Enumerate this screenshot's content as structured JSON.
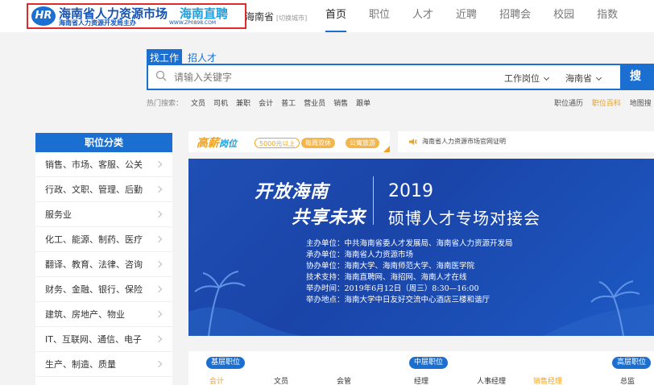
{
  "header": {
    "logo_mark": "HR",
    "logo_main": "海南省人力资源市场",
    "logo_main2": "海南直聘",
    "logo_sub": "海南省人力资源开发局主办",
    "logo_url": "WWW.ZP0898.COM",
    "city": "海南省",
    "city_switch": "[切换城市]",
    "nav": [
      {
        "label": "首页",
        "active": true
      },
      {
        "label": "职位"
      },
      {
        "label": "人才"
      },
      {
        "label": "近聘"
      },
      {
        "label": "招聘会"
      },
      {
        "label": "校园"
      },
      {
        "label": "指数"
      }
    ]
  },
  "search": {
    "tabs": [
      "找工作",
      "招人才"
    ],
    "placeholder": "请输入关键字",
    "select_type": "工作岗位",
    "select_region": "海南省",
    "button": "搜",
    "hot_label": "热门搜索：",
    "hot_items": [
      "文员",
      "司机",
      "兼职",
      "会计",
      "普工",
      "营业员",
      "销售",
      "跟单"
    ],
    "right_links": [
      {
        "label": "职位通历",
        "highlight": false
      },
      {
        "label": "职位百科",
        "highlight": true
      },
      {
        "label": "地图搜",
        "highlight": false
      }
    ]
  },
  "sidebar": {
    "title": "职位分类",
    "items": [
      "销售、市场、客服、公关",
      "行政、文职、管理、后勤",
      "服务业",
      "化工、能源、制药、医疗",
      "翻译、教育、法律、咨询",
      "财务、金融、银行、保险",
      "建筑、房地产、物业",
      "IT、互联网、通信、电子",
      "生产、制造、质量"
    ]
  },
  "promo": {
    "logo_a": "高薪",
    "logo_b": "岗位",
    "tags": [
      "5000元以上",
      "每周双休",
      "公寓旅游"
    ]
  },
  "notice": {
    "text": "海南省人力资源市场官网证明"
  },
  "banner": {
    "calli_line1": "开放海南",
    "calli_line2": "共享未来",
    "year": "2019",
    "title": "硕博人才专场对接会",
    "info": [
      "主办单位：中共海南省委人才发展局、海南省人力资源开发局",
      "承办单位：海南省人力资源市场",
      "协办单位：海南大学、海南师范大学、海南医学院",
      "技术支持：海南直聘网、海招网、海南人才在线",
      "举办时间：2019年6月12日（周三）8:30—16:00",
      "举办地点：海南大学中日友好交流中心酒店三楼和谐厅"
    ]
  },
  "levels": {
    "groups": [
      {
        "title": "基层职位",
        "items": [
          {
            "label": "会计",
            "orange": true
          },
          {
            "label": "文员"
          },
          {
            "label": "会管"
          }
        ]
      },
      {
        "title": "中层职位",
        "items": [
          {
            "label": "经理"
          },
          {
            "label": "人事经理"
          },
          {
            "label": "销售经理",
            "orange": true
          }
        ]
      },
      {
        "title": "高层职位",
        "items": [
          {
            "label": "总监"
          }
        ]
      }
    ]
  },
  "colors": {
    "brand_blue": "#1a6fd1",
    "accent_orange": "#f3a21b",
    "logo_border_red": "#e02b2b"
  }
}
